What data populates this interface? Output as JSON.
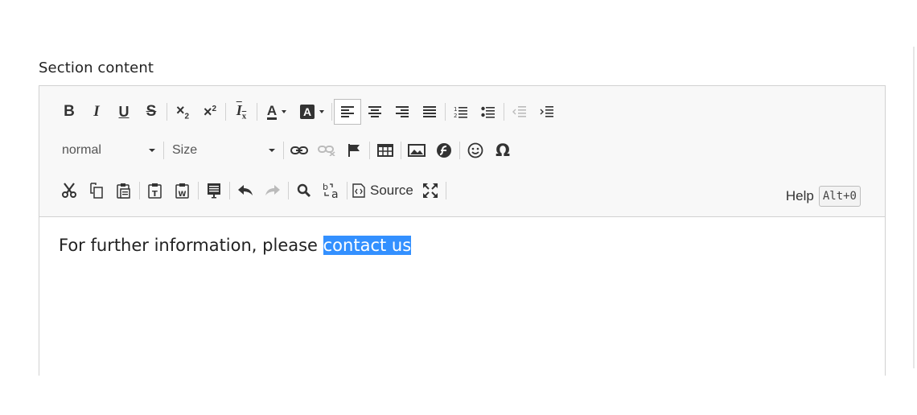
{
  "field": {
    "label": "Section content"
  },
  "toolbar": {
    "row1": [
      {
        "icon": "bold-icon",
        "glyph": "B"
      },
      {
        "icon": "italic-icon",
        "glyph": "I"
      },
      {
        "icon": "underline-icon",
        "glyph": "U"
      },
      {
        "icon": "strikethrough-icon",
        "glyph": "S"
      },
      {
        "icon": "subscript-icon",
        "glyph": "×₂"
      },
      {
        "icon": "superscript-icon",
        "glyph": "×²"
      },
      {
        "icon": "remove-format-icon",
        "glyph": "Ix"
      },
      {
        "icon": "text-color-icon",
        "glyph": "A"
      },
      {
        "icon": "background-color-icon",
        "glyph": "A"
      },
      {
        "icon": "align-left-icon"
      },
      {
        "icon": "align-center-icon"
      },
      {
        "icon": "align-right-icon"
      },
      {
        "icon": "justify-icon"
      },
      {
        "icon": "numbered-list-icon"
      },
      {
        "icon": "bulleted-list-icon"
      },
      {
        "icon": "decrease-indent-icon"
      },
      {
        "icon": "increase-indent-icon"
      }
    ],
    "format_value": "normal",
    "size_value": "Size",
    "source_label": "Source",
    "help_label": "Help",
    "help_shortcut": "Alt+0"
  },
  "content": {
    "text_before": "For further information, please ",
    "selected_text": "contact us"
  },
  "colors": {
    "selection": "#3390ff",
    "toolbar_bg": "#f8f8f8",
    "border": "#d1d1d1"
  }
}
